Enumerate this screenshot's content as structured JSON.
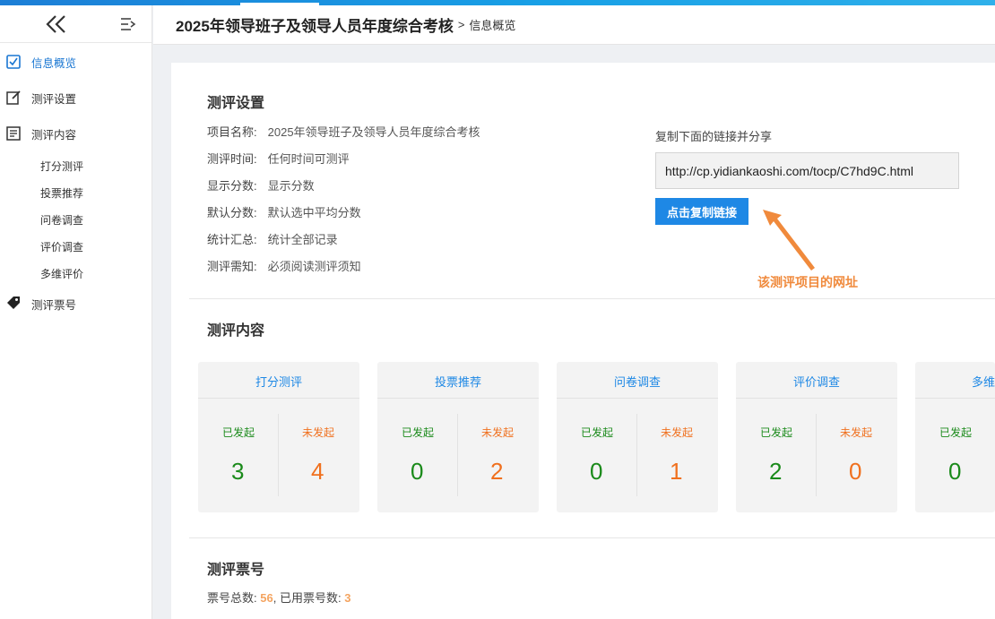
{
  "header": {
    "title": "2025年领导班子及领导人员年度综合考核",
    "separator": ">",
    "crumb": "信息概览"
  },
  "sidebar": {
    "items": [
      {
        "label": "信息概览",
        "icon": "checkbox-icon",
        "active": true
      },
      {
        "label": "测评设置",
        "icon": "edit-icon"
      },
      {
        "label": "测评内容",
        "icon": "document-icon"
      },
      {
        "label": "测评票号",
        "icon": "tag-icon"
      }
    ],
    "sub_items": [
      "打分测评",
      "投票推荐",
      "问卷调查",
      "评价调查",
      "多维评价"
    ]
  },
  "settings": {
    "title": "测评设置",
    "rows": [
      {
        "key": "项目名称:",
        "value": "2025年领导班子及领导人员年度综合考核"
      },
      {
        "key": "测评时间:",
        "value": "任何时间可测评"
      },
      {
        "key": "显示分数:",
        "value": "显示分数"
      },
      {
        "key": "默认分数:",
        "value": "默认选中平均分数"
      },
      {
        "key": "统计汇总:",
        "value": "统计全部记录"
      },
      {
        "key": "测评需知:",
        "value": "必须阅读测评须知"
      }
    ],
    "share_label": "复制下面的链接并分享",
    "link": "http://cp.yidiankaoshi.com/tocp/C7hd9C.html",
    "copy_button": "点击复制链接",
    "annotation": "该测评项目的网址"
  },
  "content": {
    "title": "测评内容",
    "cards": [
      {
        "title": "打分测评",
        "started_label": "已发起",
        "pending_label": "未发起",
        "started": "3",
        "pending": "4"
      },
      {
        "title": "投票推荐",
        "started_label": "已发起",
        "pending_label": "未发起",
        "started": "0",
        "pending": "2"
      },
      {
        "title": "问卷调查",
        "started_label": "已发起",
        "pending_label": "未发起",
        "started": "0",
        "pending": "1"
      },
      {
        "title": "评价调查",
        "started_label": "已发起",
        "pending_label": "未发起",
        "started": "2",
        "pending": "0"
      },
      {
        "title": "多维",
        "started_label": "已发起",
        "pending_label": "",
        "started": "0",
        "pending": ""
      }
    ]
  },
  "tickets": {
    "title": "测评票号",
    "total_label": "票号总数:",
    "total": "56",
    "sep": ",",
    "used_label": "已用票号数:",
    "used": "3"
  },
  "colors": {
    "accent": "#1e88e5",
    "started": "#1a8a1a",
    "pending": "#f0701e",
    "annotation": "#f08a3c"
  }
}
